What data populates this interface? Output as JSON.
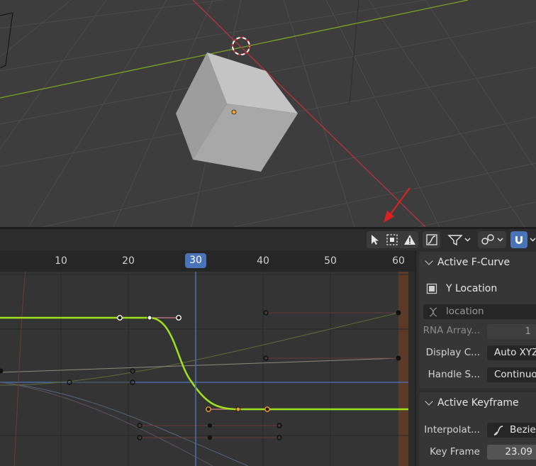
{
  "viewport": {
    "description_icons": [
      "cursor-icon"
    ]
  },
  "toolbar": {
    "icons": [
      "select-tool-icon",
      "box-select-icon",
      "warning-icon",
      "normalize-icon",
      "filter-icon",
      "proportional-icon",
      "snap-icon"
    ]
  },
  "graph": {
    "ruler_ticks": [
      "10",
      "20",
      "30",
      "40",
      "50",
      "60"
    ],
    "current_frame": "30"
  },
  "panel": {
    "active_fcurve": {
      "title": "Active F-Curve",
      "channel_name": "Y Location",
      "data_path": "location",
      "rna_array_label": "RNA Array...",
      "rna_array_value": "1",
      "display_color_label": "Display C...",
      "display_color_value": "Auto XYZ",
      "handle_smoothing_label": "Handle S...",
      "handle_smoothing_value": "Continuous"
    },
    "active_keyframe": {
      "title": "Active Keyframe",
      "interpolation_label": "Interpolat...",
      "interpolation_value": "Bezier",
      "key_frame_label": "Key Frame",
      "key_frame_value": "23.09"
    }
  },
  "colors": {
    "accent": "#4a72b7",
    "active_curve": "#9ee21c",
    "selected_handle": "#f09d2a",
    "annotation_arrow": "#e02020"
  }
}
